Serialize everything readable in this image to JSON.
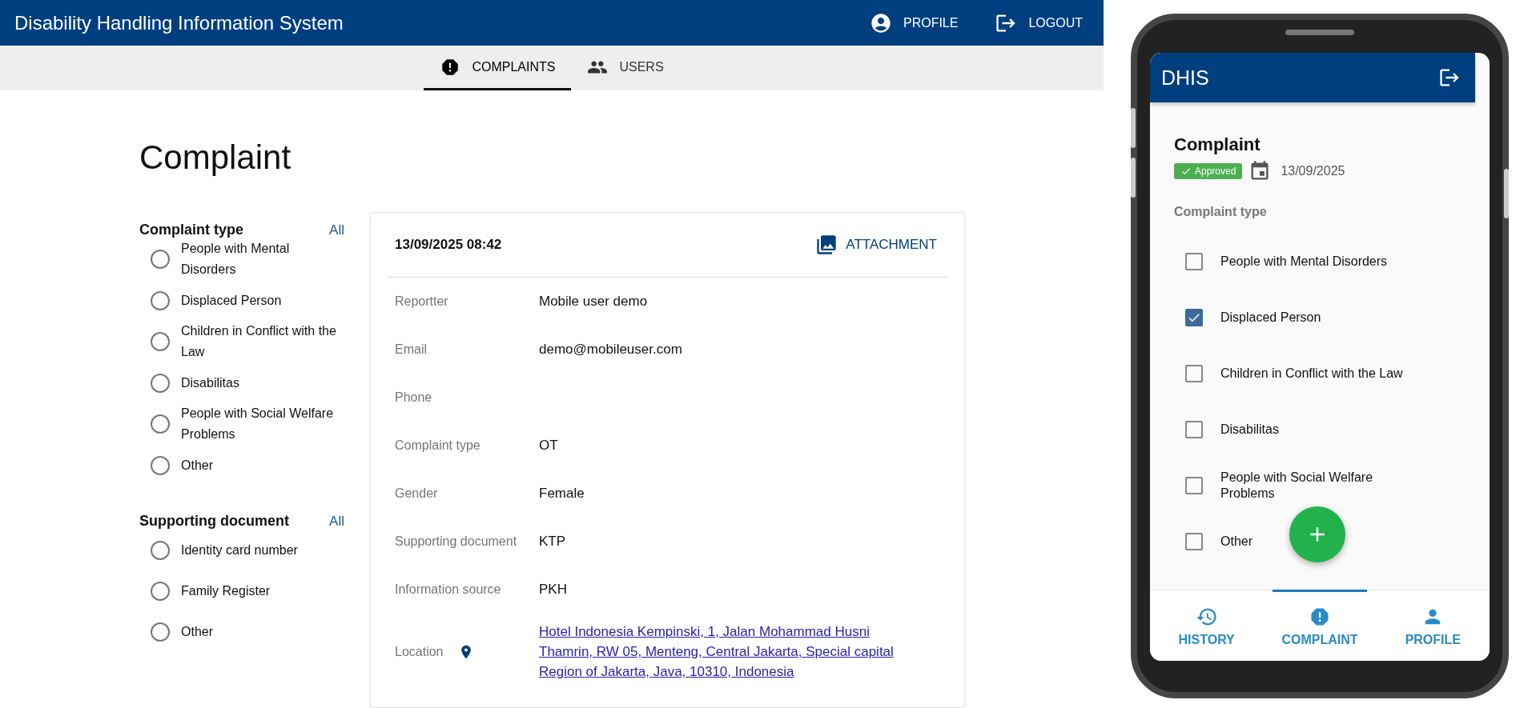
{
  "header": {
    "title": "Disability Handling Information System",
    "actions": [
      {
        "kind": "profile",
        "label": "PROFILE"
      },
      {
        "kind": "logout",
        "label": "LOGOUT"
      }
    ]
  },
  "tabs": [
    {
      "kind": "complaints",
      "label": "COMPLAINTS",
      "selected": true
    },
    {
      "kind": "users",
      "label": "USERS",
      "selected": false
    }
  ],
  "page_title": "Complaint",
  "filters": [
    {
      "title": "Complaint type",
      "all_link": "All",
      "options": [
        {
          "label": "People with Mental Disorders",
          "selected": false
        },
        {
          "label": "Displaced Person",
          "selected": false
        },
        {
          "label": "Children in Conflict with the Law",
          "selected": false
        },
        {
          "label": "Disabilitas",
          "selected": false
        },
        {
          "label": "People with Social Welfare Problems",
          "selected": false
        },
        {
          "label": "Other",
          "selected": false
        }
      ]
    },
    {
      "title": "Supporting document",
      "all_link": "All",
      "options": [
        {
          "label": "Identity card number",
          "selected": false
        },
        {
          "label": "Family Register",
          "selected": false
        },
        {
          "label": "Other",
          "selected": false
        }
      ]
    }
  ],
  "detail": {
    "datetime": "13/09/2025 08:42",
    "attachment_button": "ATTACHMENT",
    "fields": [
      {
        "label": "Reportter",
        "value": "Mobile user demo"
      },
      {
        "label": "Email",
        "value": "demo@mobileuser.com"
      },
      {
        "label": "Phone"
      },
      {
        "label": "Complaint type",
        "value": "OT"
      },
      {
        "label": "Gender",
        "value": "Female"
      },
      {
        "label": "Supporting document",
        "value": "KTP"
      },
      {
        "label": "Information source",
        "value": "PKH"
      },
      {
        "label": "Location",
        "kind": "location",
        "value": "Hotel Indonesia Kempinski, 1, Jalan Mohammad Husni Thamrin, RW 05, Menteng, Central Jakarta, Special capital Region of Jakarta, Java, 10310, Indonesia"
      }
    ]
  },
  "phone": {
    "app_title": "DHIS",
    "title": "Complaint",
    "status": "Approved",
    "date": "13/09/2025",
    "section": "Complaint type",
    "options": [
      {
        "label": "People with Mental Disorders",
        "checked": false
      },
      {
        "label": "Displaced Person",
        "checked": true
      },
      {
        "label": "Children in Conflict with the Law",
        "checked": false
      },
      {
        "label": "Disabilitas",
        "checked": false
      },
      {
        "label": "People with Social Welfare Problems",
        "checked": false
      },
      {
        "label": "Other",
        "checked": false
      }
    ],
    "nav": [
      {
        "kind": "history",
        "label": "HISTORY",
        "selected": false
      },
      {
        "kind": "complaint",
        "label": "COMPLAINT",
        "selected": true
      },
      {
        "kind": "profile",
        "label": "PROFILE",
        "selected": false
      }
    ]
  }
}
